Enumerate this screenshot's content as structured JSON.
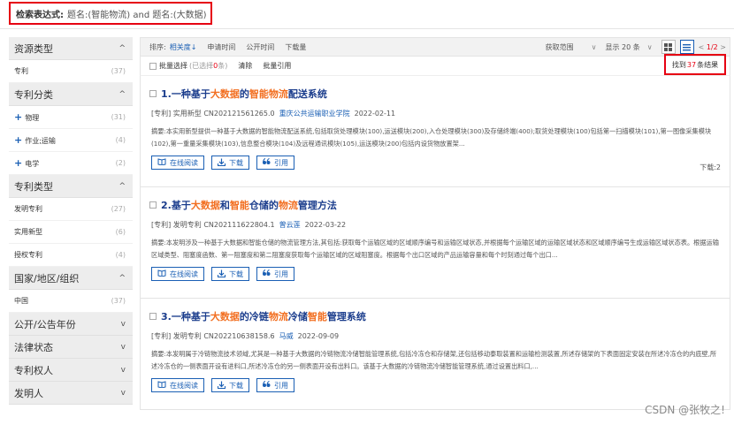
{
  "search_expr": {
    "label": "检索表达式:",
    "value": "题名:(智能物流) and 题名:(大数据)"
  },
  "sidebar": [
    {
      "name": "资源类型",
      "chevron": "^",
      "items": [
        {
          "label": "专利",
          "count": "(37)",
          "plus": ""
        }
      ]
    },
    {
      "name": "专利分类",
      "chevron": "^",
      "items": [
        {
          "label": "物理",
          "count": "(31)",
          "plus": "+"
        },
        {
          "label": "作业;运输",
          "count": "(4)",
          "plus": "+"
        },
        {
          "label": "电学",
          "count": "(2)",
          "plus": "+"
        }
      ]
    },
    {
      "name": "专利类型",
      "chevron": "^",
      "items": [
        {
          "label": "发明专利",
          "count": "(27)",
          "plus": ""
        },
        {
          "label": "实用新型",
          "count": "(6)",
          "plus": ""
        },
        {
          "label": "授权专利",
          "count": "(4)",
          "plus": ""
        }
      ]
    },
    {
      "name": "国家/地区/组织",
      "chevron": "^",
      "items": [
        {
          "label": "中国",
          "count": "(37)",
          "plus": ""
        }
      ]
    },
    {
      "name": "公开/公告年份",
      "chevron": "v",
      "items": []
    },
    {
      "name": "法律状态",
      "chevron": "v",
      "items": []
    },
    {
      "name": "专利权人",
      "chevron": "v",
      "items": []
    },
    {
      "name": "发明人",
      "chevron": "v",
      "items": []
    }
  ],
  "toolbar": {
    "sort_label": "排序:",
    "sort_relevance": "相关度↓",
    "sort_apply_date": "申请时间",
    "sort_pub_date": "公开时间",
    "sort_downloads": "下载量",
    "fetch_range": "获取范围",
    "show_count": "显示 20 条",
    "dropdown_arrow": "∨",
    "grid_view_icon": "grid-icon",
    "list_view_icon": "list-icon",
    "pager_prev": "<",
    "pager_current": "1",
    "pager_total": "/2",
    "pager_next": ">"
  },
  "actionbar": {
    "batch_select": "批量选择",
    "selected_prefix": "(已选择",
    "selected_count": "0",
    "selected_suffix": "条)",
    "clear": "清除",
    "batch_cite": "批量引用",
    "found_prefix": "找到",
    "found_count": "37",
    "found_suffix": "条结果"
  },
  "results": [
    {
      "index": "1.",
      "title_parts": [
        {
          "t": "一种基于",
          "hl": false
        },
        {
          "t": "大数据",
          "hl": true
        },
        {
          "t": "的",
          "hl": false
        },
        {
          "t": "智能物流",
          "hl": true
        },
        {
          "t": "配送系统",
          "hl": false
        }
      ],
      "meta_prefix": "[专利] 实用新型  CN202121561265.0",
      "meta_author": "重庆公共运输职业学院",
      "meta_date": "2022-02-11",
      "abstract": "摘要:本实用新型提供一种基于大数据的智能物流配送系统,包括取货处理模块(100),运送模块(200),入仓处理模块(300)及存储终端(400);取货处理模块(100)包括第一扫描模块(101),第一图像采集模块(102),第一重量采集模块(103),信息整合模块(104)及远程通讯模块(105),运送模块(200)包括内设货物放置架...",
      "downloads": "下载:2"
    },
    {
      "index": "2.",
      "title_parts": [
        {
          "t": "基于",
          "hl": false
        },
        {
          "t": "大数据",
          "hl": true
        },
        {
          "t": "和",
          "hl": false
        },
        {
          "t": "智能",
          "hl": true
        },
        {
          "t": "仓储的",
          "hl": false
        },
        {
          "t": "物流",
          "hl": true
        },
        {
          "t": "管理方法",
          "hl": false
        }
      ],
      "meta_prefix": "[专利] 发明专利  CN202111622804.1",
      "meta_author": "曾云莲",
      "meta_date": "2022-03-22",
      "abstract": "摘要:本发明涉及一种基于大数据和智能仓储的物流管理方法,其包括:获取每个运输区域的区域顺序编号和运输区域状态,并根据每个运输区域的运输区域状态和区域顺序编号生成运输区域状态表。根据运输区域类型、阻塞度函数、第一阻塞度和第二阻塞度获取每个运输区域的区域阻塞度。根据每个出口区域的产品运输容量和每个时刻通过每个出口...",
      "downloads": ""
    },
    {
      "index": "3.",
      "title_parts": [
        {
          "t": "一种基于",
          "hl": false
        },
        {
          "t": "大数据",
          "hl": true
        },
        {
          "t": "的冷链",
          "hl": false
        },
        {
          "t": "物流",
          "hl": true
        },
        {
          "t": "冷储",
          "hl": false
        },
        {
          "t": "智能",
          "hl": true
        },
        {
          "t": "管理系统",
          "hl": false
        }
      ],
      "meta_prefix": "[专利] 发明专利  CN202210638158.6",
      "meta_author": "马威",
      "meta_date": "2022-09-09",
      "abstract": "摘要:本发明属于冷链物流技术领域,尤其是一种基于大数据的冷链物流冷储智能管理系统,包括冷冻仓和存储架,还包括移动泰取装置和运输检测装置,所述存储架的下表面固定安装在所述冷冻仓的内底壁,所述冷冻仓的一侧表面开设有进料口,所述冷冻仓的另一侧表面开设有出料口。该基于大数据的冷链物流冷储智能管理系统,通过设置出料口,...",
      "downloads": ""
    }
  ],
  "buttons": {
    "read": "在线阅读",
    "download": "下载",
    "cite": "引用"
  },
  "watermark": "CSDN @张牧之!",
  "colors": {
    "accent": "#1a5fb4",
    "highlight": "#f26f21",
    "alert": "#e60012"
  }
}
